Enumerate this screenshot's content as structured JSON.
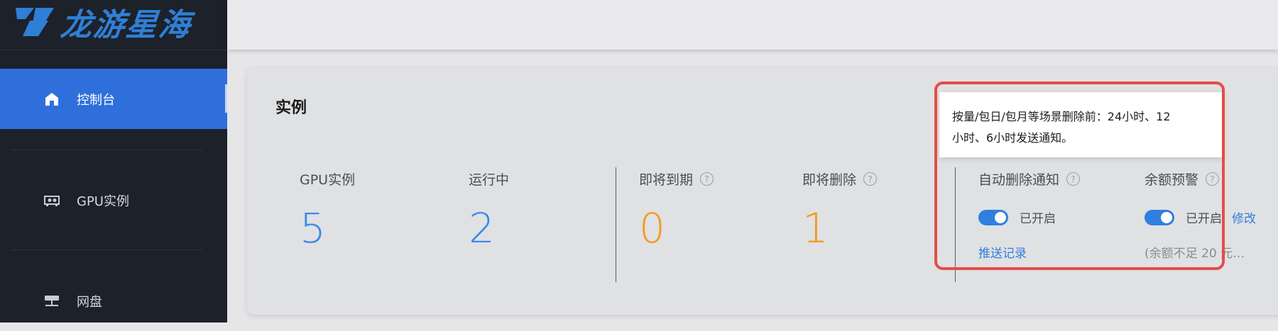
{
  "brand": {
    "name": "龙游星海"
  },
  "sidebar": {
    "items": [
      {
        "label": "控制台",
        "icon": "home-icon",
        "active": true
      },
      {
        "label": "GPU实例",
        "icon": "gpu-card-icon",
        "active": false
      },
      {
        "label": "网盘",
        "icon": "network-drive-icon",
        "active": false
      }
    ]
  },
  "card": {
    "title": "实例",
    "stats": [
      {
        "label": "GPU实例",
        "value": "5",
        "color": "#3a8bea"
      },
      {
        "label": "运行中",
        "value": "2",
        "color": "#3a8bea"
      },
      {
        "label": "即将到期",
        "value": "0",
        "color": "#f59a22",
        "help": true
      },
      {
        "label": "即将删除",
        "value": "1",
        "color": "#f59a22",
        "help": true
      }
    ],
    "auto_delete": {
      "label": "自动删除通知",
      "status": "已开启",
      "link": "推送记录"
    },
    "balance_alert": {
      "label": "余额预警",
      "status": "已开启",
      "edit": "修改",
      "note": "(余额不足 20 元…"
    }
  },
  "tooltip": {
    "line1": "按量/包日/包月等场景删除前：24小时、12",
    "line2": "小时、6小时发送通知。"
  },
  "colors": {
    "accent": "#2f6fdc",
    "highlight": "#e64c48",
    "sidebar_bg": "#1d2129"
  }
}
